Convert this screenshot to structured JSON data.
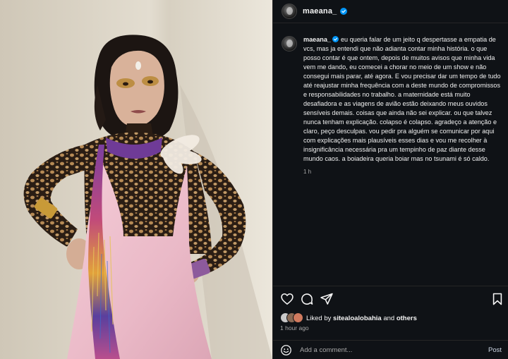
{
  "post": {
    "username": "maeana_",
    "caption": "eu queria falar de um jeito q despertasse a empatia de vcs, mas ja entendi que não adianta contar minha história. o que posso contar é que ontem, depois de muitos avisos que minha vida vem me dando, eu comecei a chorar no meio de um show e não consegui mais parar, até agora. E vou precisar dar um tempo de tudo até reajustar minha frequência com a deste mundo de compromissos e responsabilidades no trabalho. a maternidade está muito desafiadora e as viagens de avião estão deixando meus ouvidos sensíveis demais. coisas que ainda não sei explicar. ou que talvez nunca tenham explicação. colapso é colapso. agradeço a atenção e claro, peço desculpas. vou pedir pra alguém se comunicar por aqui com explicações mais plausíveis esses dias e vou me recolher à insignificância necessária pra um tempinho de paz diante desse mundo caos. a boiadeira queria boiar mas no tsunami é só caldo.",
    "caption_time": "1 h",
    "liked_prefix": "Liked by",
    "liked_user": "sitealoalobahia",
    "liked_and": "and",
    "liked_others": "others",
    "post_time": "1 hour ago"
  },
  "comment": {
    "placeholder": "Add a comment...",
    "post_label": "Post"
  },
  "icons": {
    "header_avatar": "profile-avatar",
    "verified": "verified-badge-icon",
    "like": "heart-icon",
    "comment": "comment-icon",
    "share": "send-icon",
    "save": "bookmark-icon",
    "emoji": "emoji-icon"
  },
  "colors": {
    "panel_bg": "#0f1216",
    "verified_blue": "#0095f6",
    "secondary_text": "#a8a8a8",
    "divider": "#262626"
  }
}
